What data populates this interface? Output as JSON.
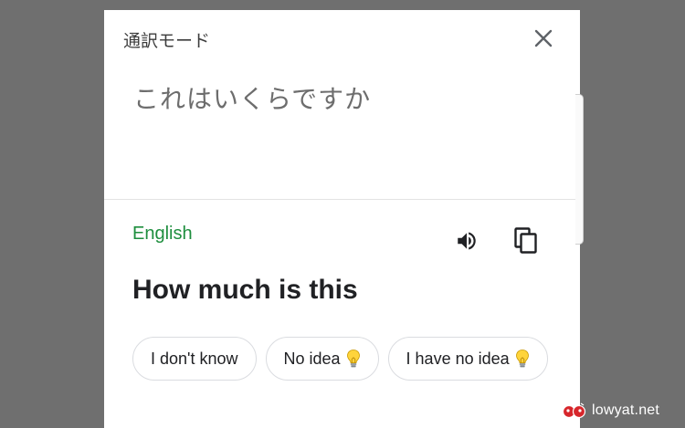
{
  "dialog": {
    "title": "通訳モード",
    "close_icon": "close-icon",
    "source_text": "これはいくらですか"
  },
  "result": {
    "language": "English",
    "speaker_icon": "speaker-icon",
    "copy_icon": "copy-icon",
    "translation": "How much is this"
  },
  "suggestions": [
    {
      "label": "I don't know",
      "icon": ""
    },
    {
      "label": "No idea",
      "icon": "lightbulb-icon"
    },
    {
      "label": "I have no idea",
      "icon": "lightbulb-icon"
    }
  ],
  "watermark": {
    "text": "lowyat.net"
  },
  "colors": {
    "language_accent": "#1e8e3e",
    "backdrop": "#6f6f6f"
  }
}
